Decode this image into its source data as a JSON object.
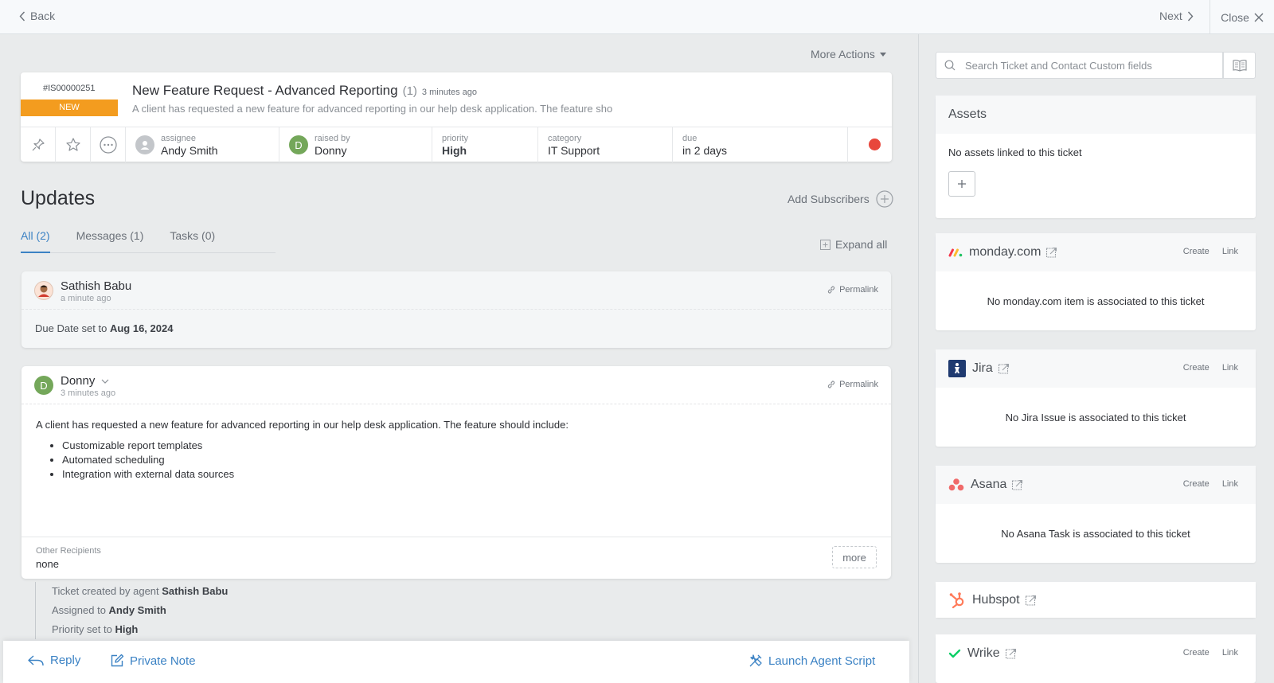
{
  "topbar": {
    "back_label": "Back",
    "next_label": "Next",
    "close_label": "Close"
  },
  "main": {
    "more_actions": "More Actions",
    "ticket": {
      "id": "#IS00000251",
      "status": "NEW",
      "title": "New Feature Request - Advanced Reporting",
      "count": "(1)",
      "time": "3 minutes ago",
      "description": "A client has requested a new feature for advanced reporting in our help desk application. The feature sho",
      "assignee_label": "assignee",
      "assignee": "Andy Smith",
      "raised_by_label": "raised by",
      "raised_by": "Donny",
      "raised_by_initial": "D",
      "priority_label": "priority",
      "priority": "High",
      "category_label": "category",
      "category": "IT Support",
      "due_label": "due",
      "due": "in 2 days"
    },
    "updates_title": "Updates",
    "add_subscribers": "Add Subscribers",
    "tabs": [
      {
        "label": "All (2)"
      },
      {
        "label": "Messages (1)"
      },
      {
        "label": "Tasks (0)"
      }
    ],
    "expand_all": "Expand all",
    "entries": [
      {
        "author": "Sathish Babu",
        "time": "a minute ago",
        "permalink": "Permalink",
        "text_prefix": "Due Date set to ",
        "text_bold": "Aug 16, 2024"
      },
      {
        "author": "Donny",
        "initial": "D",
        "time": "3 minutes ago",
        "permalink": "Permalink",
        "intro": "A client has requested a new feature for advanced reporting in our help desk application. The feature should include:",
        "bullets": [
          "Customizable report templates",
          "Automated scheduling",
          "Integration with external data sources"
        ],
        "recipients_label": "Other Recipients",
        "recipients": "none",
        "more_label": "more"
      }
    ],
    "activity": [
      {
        "prefix": "Ticket created by agent ",
        "bold": "Sathish Babu"
      },
      {
        "prefix": "Assigned to ",
        "bold": "Andy Smith"
      },
      {
        "prefix": "Priority set to ",
        "bold": "High"
      }
    ],
    "reply_bar": {
      "reply": "Reply",
      "private_note": "Private Note",
      "launch_script": "Launch Agent Script"
    }
  },
  "side": {
    "search_placeholder": "Search Ticket and Contact Custom fields",
    "assets": {
      "title": "Assets",
      "empty": "No assets linked to this ticket"
    },
    "integrations": [
      {
        "name": "monday.com",
        "create": "Create",
        "link": "Link",
        "empty": "No monday.com item is associated to this ticket"
      },
      {
        "name": "Jira",
        "create": "Create",
        "link": "Link",
        "empty": "No Jira Issue is associated to this ticket"
      },
      {
        "name": "Asana",
        "create": "Create",
        "link": "Link",
        "empty": "No Asana Task is associated to this ticket"
      },
      {
        "name": "Hubspot"
      },
      {
        "name": "Wrike",
        "create": "Create",
        "link": "Link"
      }
    ]
  },
  "colors": {
    "accent": "#3b82c4",
    "status_new": "#f39c1f",
    "due_dot": "#e8473c",
    "avatar_green": "#74a75a"
  }
}
